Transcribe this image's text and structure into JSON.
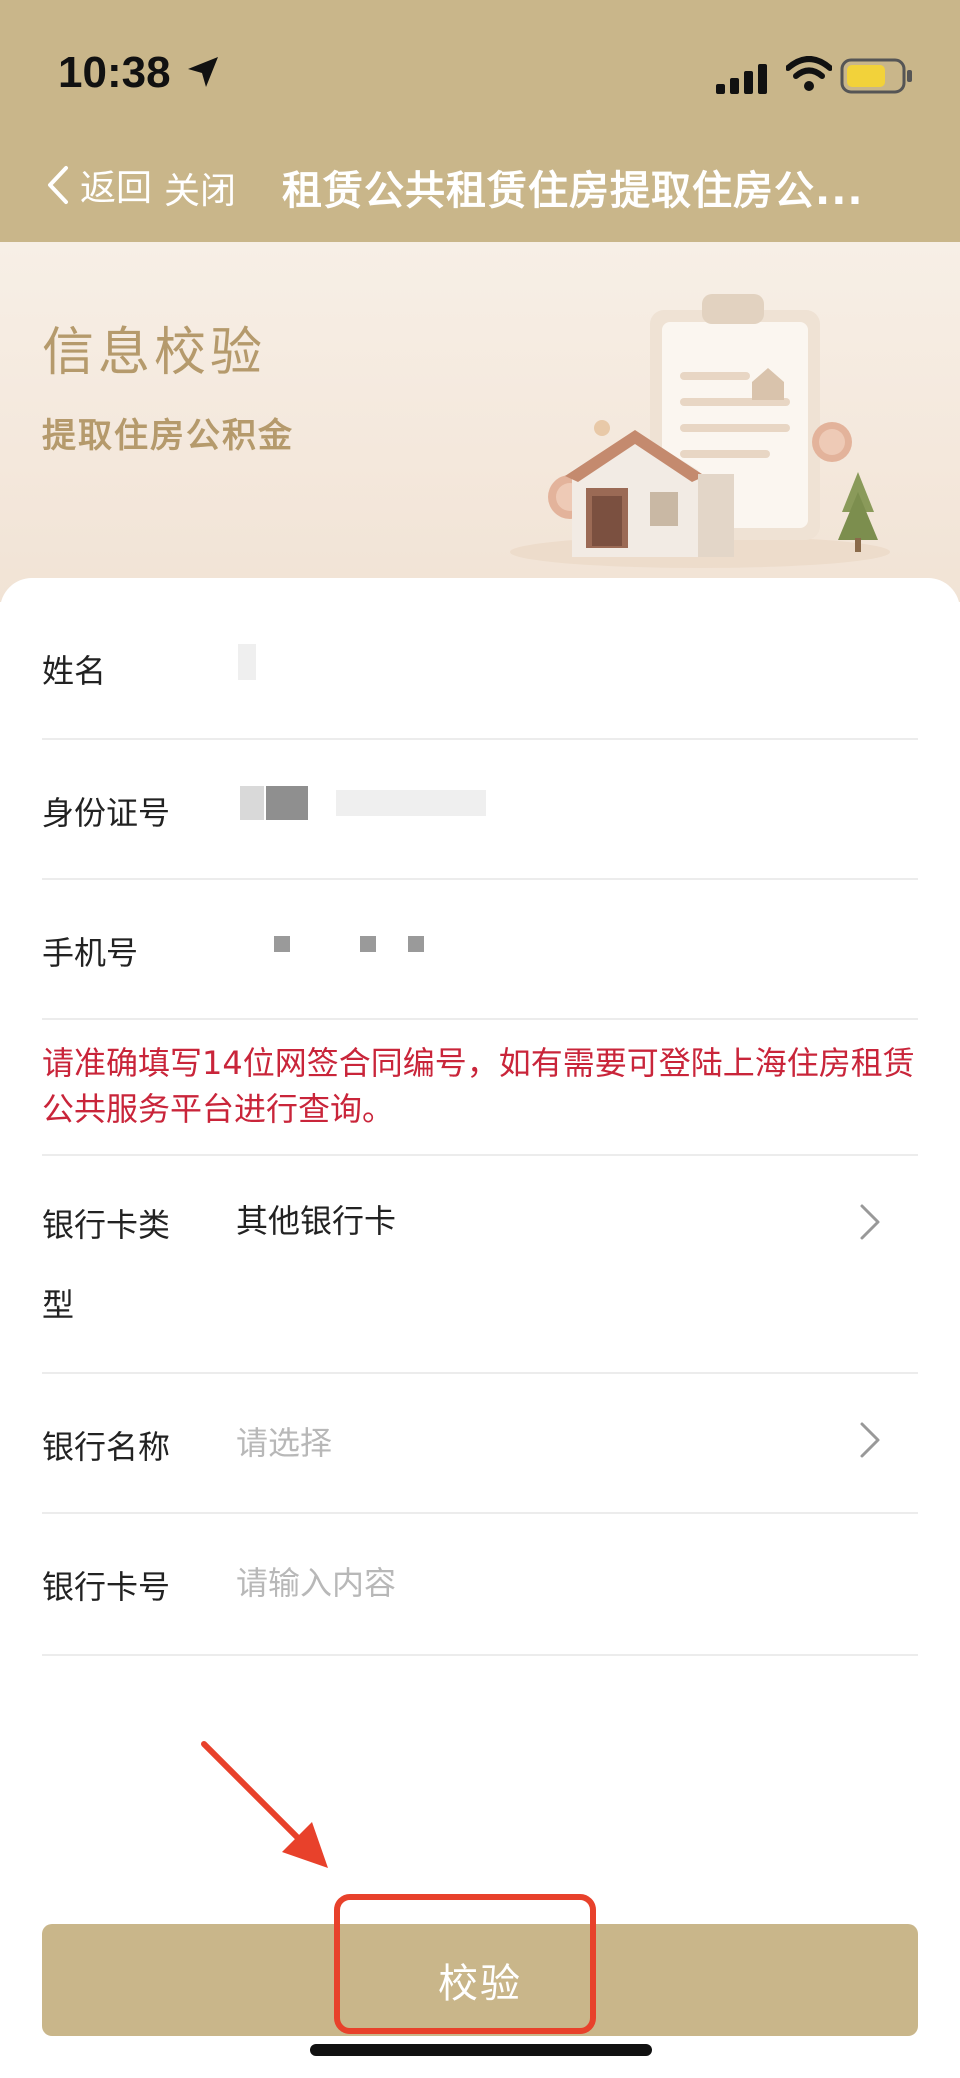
{
  "status_bar": {
    "time": "10:38"
  },
  "nav": {
    "back_label": "返回",
    "close_label": "关闭",
    "title": "租赁公共租赁住房提取住房公..."
  },
  "banner": {
    "title": "信息校验",
    "subtitle": "提取住房公积金"
  },
  "form": {
    "name_label": "姓名",
    "id_label": "身份证号",
    "phone_label": "手机号",
    "notice": "请准确填写14位网签合同编号，如有需要可登陆上海住房租赁公共服务平台进行查询。",
    "bank_card_type_label_1": "银行卡类",
    "bank_card_type_label_2": "型",
    "bank_card_type_value": "其他银行卡",
    "bank_name_label": "银行名称",
    "bank_name_placeholder": "请选择",
    "bank_card_number_label": "银行卡号",
    "bank_card_number_placeholder": "请输入内容"
  },
  "actions": {
    "verify_label": "校验"
  },
  "colors": {
    "header": "#c9b68a",
    "banner_text": "#b59a6c",
    "notice": "#c9253a",
    "highlight": "#e8412b"
  }
}
